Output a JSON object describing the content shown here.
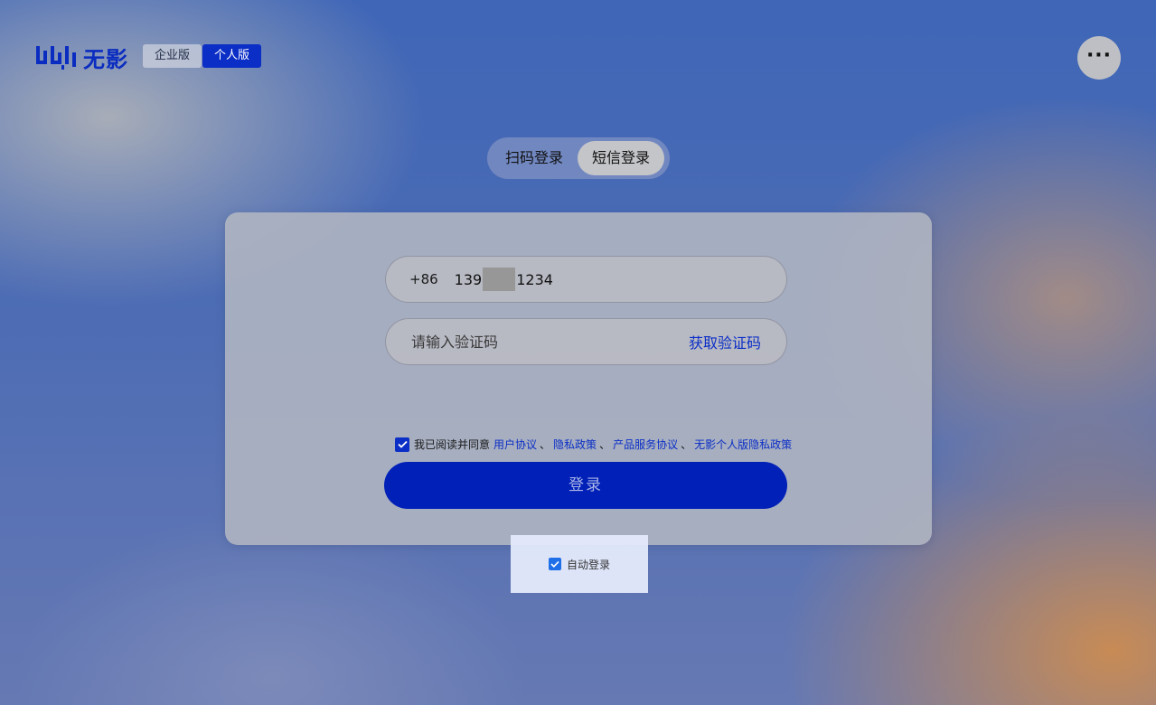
{
  "brand": {
    "name": "无影",
    "color": "#0a2cc0"
  },
  "edition_switch": {
    "enterprise_label": "企业版",
    "personal_label": "个人版",
    "selected": "个人版"
  },
  "more_button": {
    "icon": "more-horizontal-icon",
    "label": "···"
  },
  "login_tabs": {
    "qr_label": "扫码登录",
    "sms_label": "短信登录",
    "selected": "短信登录"
  },
  "form": {
    "country_code": "+86",
    "phone_prefix": "139",
    "phone_suffix": "1234",
    "code_placeholder": "请输入验证码",
    "get_code_label": "获取验证码",
    "agreement": {
      "checked": true,
      "prefix": "我已阅读并同意",
      "links": [
        "用户协议",
        "隐私政策",
        "产品服务协议",
        "无影个人版隐私政策"
      ],
      "separator": "、"
    },
    "submit_label": "登录"
  },
  "auto_login": {
    "checked": true,
    "label": "自动登录"
  },
  "colors": {
    "primary": "#0b2ec6",
    "button": "#0020b8",
    "checkbox_auto": "#1f6fe8"
  }
}
